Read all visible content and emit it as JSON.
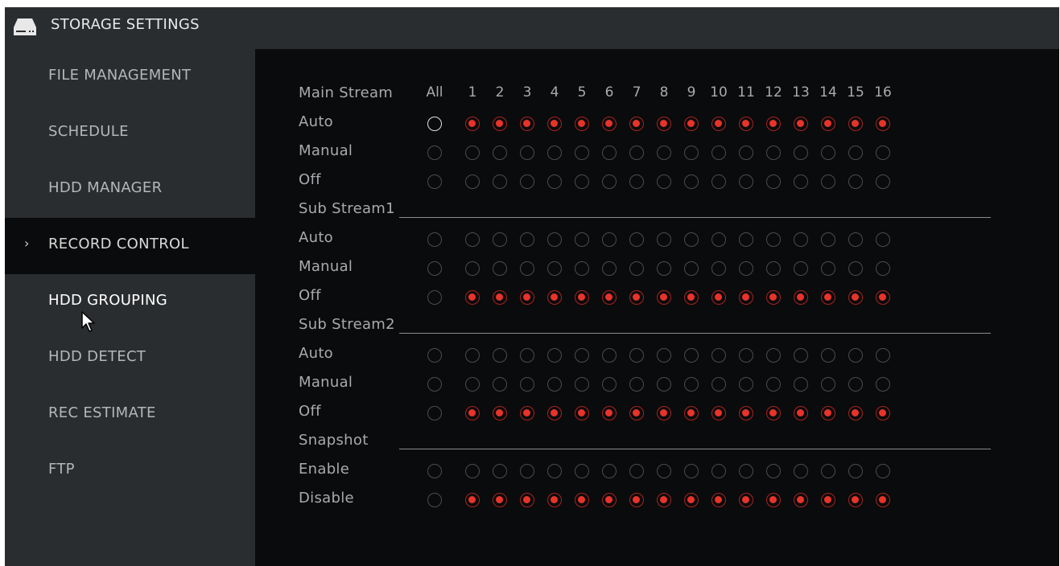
{
  "window": {
    "title": "STORAGE SETTINGS",
    "icon": "hdd-icon"
  },
  "sidebar": {
    "active_indicator": "›",
    "items": [
      {
        "label": "FILE MANAGEMENT",
        "key": "file-management"
      },
      {
        "label": "SCHEDULE",
        "key": "schedule"
      },
      {
        "label": "HDD MANAGER",
        "key": "hdd-manager"
      },
      {
        "label": "RECORD CONTROL",
        "key": "record-control",
        "active": true
      },
      {
        "label": "HDD GROUPING",
        "key": "hdd-grouping",
        "hover": true
      },
      {
        "label": "HDD DETECT",
        "key": "hdd-detect"
      },
      {
        "label": "REC ESTIMATE",
        "key": "rec-estimate"
      },
      {
        "label": "FTP",
        "key": "ftp"
      }
    ]
  },
  "record_control": {
    "header": {
      "label": "Main Stream",
      "all_label": "All",
      "channels": [
        "1",
        "2",
        "3",
        "4",
        "5",
        "6",
        "7",
        "8",
        "9",
        "10",
        "11",
        "12",
        "13",
        "14",
        "15",
        "16"
      ]
    },
    "sections": [
      {
        "key": "main-stream",
        "title": null,
        "rows": [
          {
            "label": "Auto",
            "all_checked": false,
            "all_highlight": true,
            "channels_checked": true
          },
          {
            "label": "Manual",
            "all_checked": false,
            "channels_checked": false
          },
          {
            "label": "Off",
            "all_checked": false,
            "channels_checked": false
          }
        ]
      },
      {
        "key": "sub-stream1",
        "title": "Sub Stream1",
        "rows": [
          {
            "label": "Auto",
            "all_checked": false,
            "channels_checked": false
          },
          {
            "label": "Manual",
            "all_checked": false,
            "channels_checked": false
          },
          {
            "label": "Off",
            "all_checked": false,
            "channels_checked": true
          }
        ]
      },
      {
        "key": "sub-stream2",
        "title": "Sub Stream2",
        "rows": [
          {
            "label": "Auto",
            "all_checked": false,
            "channels_checked": false
          },
          {
            "label": "Manual",
            "all_checked": false,
            "channels_checked": false
          },
          {
            "label": "Off",
            "all_checked": false,
            "channels_checked": true
          }
        ]
      },
      {
        "key": "snapshot",
        "title": "Snapshot",
        "rows": [
          {
            "label": "Enable",
            "all_checked": false,
            "channels_checked": false
          },
          {
            "label": "Disable",
            "all_checked": false,
            "channels_checked": true
          }
        ]
      }
    ]
  },
  "colors": {
    "accent_red": "#e8332b",
    "panel_bg": "#2a2d30",
    "content_bg": "#0a0b0c"
  }
}
